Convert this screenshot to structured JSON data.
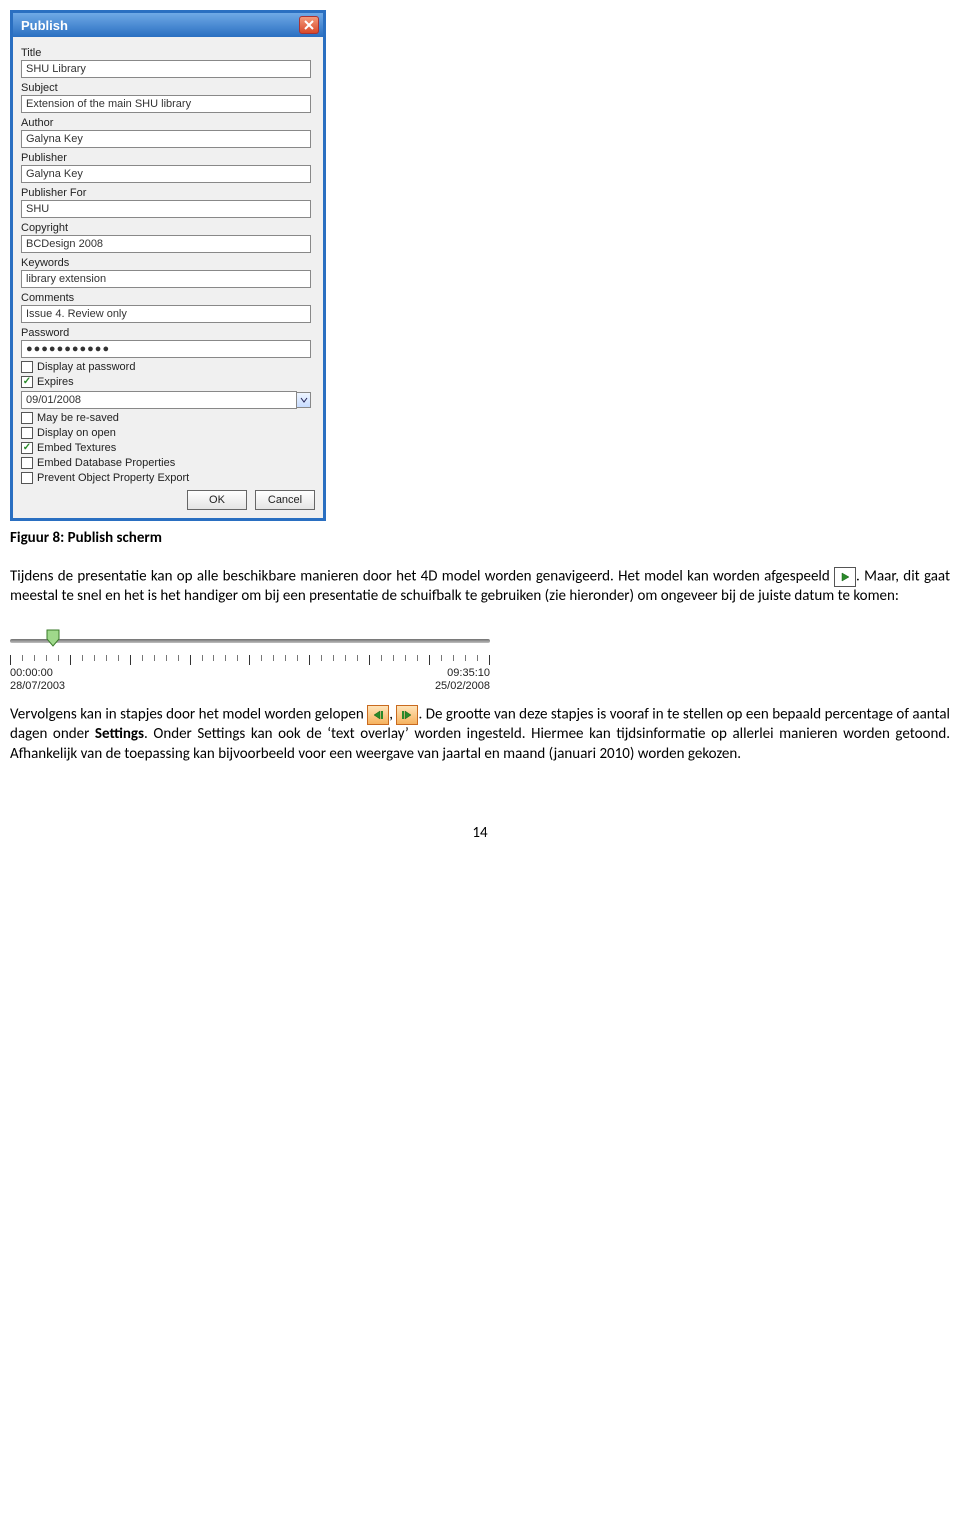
{
  "dialog": {
    "title": "Publish",
    "fields": {
      "title_label": "Title",
      "title_value": "SHU Library",
      "subject_label": "Subject",
      "subject_value": "Extension of the main SHU library",
      "author_label": "Author",
      "author_value": "Galyna Key",
      "publisher_label": "Publisher",
      "publisher_value": "Galyna Key",
      "publisher_for_label": "Publisher For",
      "publisher_for_value": "SHU",
      "copyright_label": "Copyright",
      "copyright_value": "BCDesign 2008",
      "keywords_label": "Keywords",
      "keywords_value": "library extension",
      "comments_label": "Comments",
      "comments_value": "Issue 4. Review only",
      "password_label": "Password",
      "password_value": "●●●●●●●●●●●",
      "display_at_password": "Display at password",
      "expires": "Expires",
      "expires_date": "09/01/2008",
      "may_be_resaved": "May be re-saved",
      "display_on_open": "Display on open",
      "embed_textures": "Embed Textures",
      "embed_db_props": "Embed Database Properties",
      "prevent_export": "Prevent Object Property Export"
    },
    "buttons": {
      "ok": "OK",
      "cancel": "Cancel"
    }
  },
  "doc": {
    "caption": "Figuur 8: Publish scherm",
    "p1": "Tijdens de presentatie kan op alle beschikbare manieren door het 4D model worden genavigeerd. Het model kan worden afgespeeld ",
    "p1b": ". Maar, dit gaat meestal te snel en het is het handiger om bij een presentatie de schuifbalk te gebruiken (zie hieronder) om ongeveer bij de juiste datum te komen:",
    "p2a": "Vervolgens kan in stapjes door het model worden gelopen ",
    "p2b": ", ",
    "p2c": ". De grootte van deze stapjes is vooraf in te stellen op een bepaald percentage of aantal dagen onder ",
    "p2_settings": "Settings",
    "p2d": ". Onder Settings kan ook de ‘text overlay’ worden ingesteld. Hiermee kan tijdsinformatie op allerlei manieren worden getoond. Afhankelijk van de toepassing kan bijvoorbeeld voor een weergave van jaartal en maand (januari 2010) worden gekozen."
  },
  "slider": {
    "start_time": "00:00:00",
    "start_date": "28/07/2003",
    "end_time": "09:35:10",
    "end_date": "25/02/2008"
  },
  "page_number": "14"
}
